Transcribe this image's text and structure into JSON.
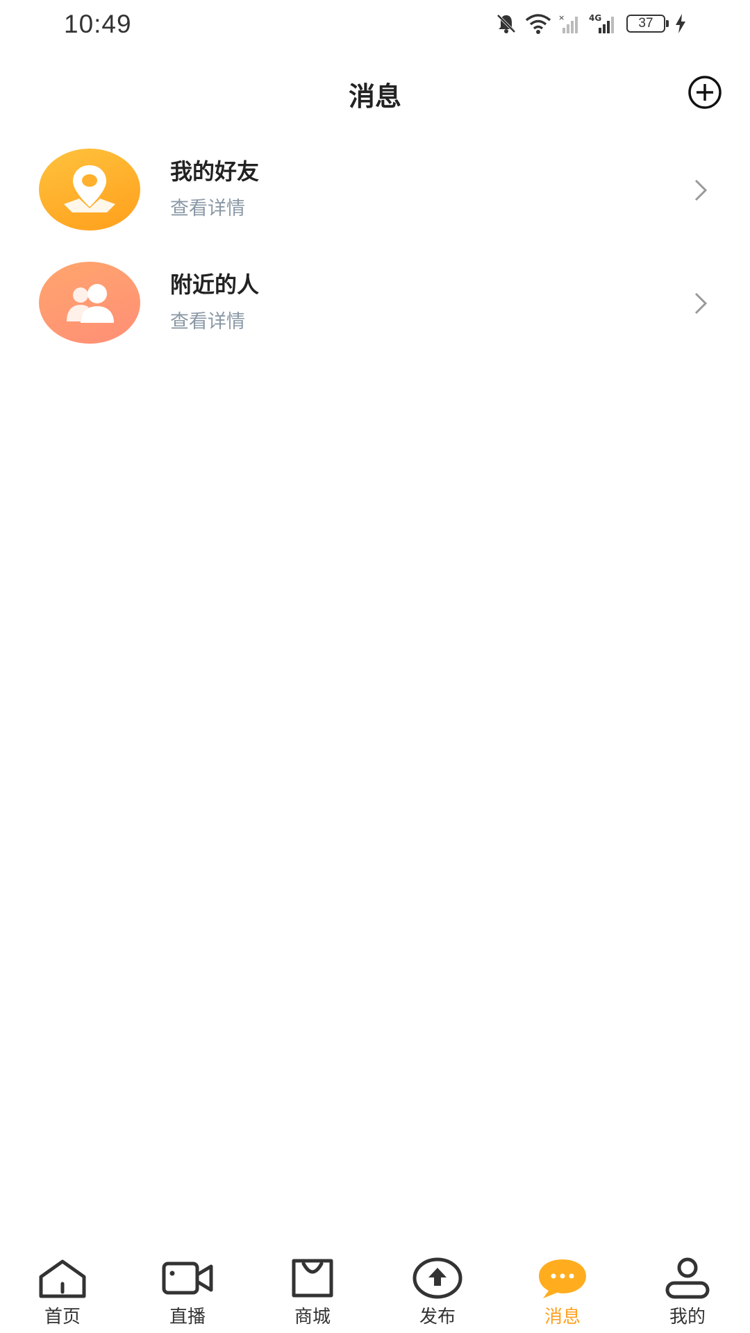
{
  "status_bar": {
    "time": "10:49",
    "battery": "37",
    "network": "4G"
  },
  "header": {
    "title": "消息",
    "add_icon": "plus-circle-icon"
  },
  "list": {
    "items": [
      {
        "title": "我的好友",
        "subtitle": "查看详情",
        "icon": "location-pin-icon",
        "color": "#ffb02e"
      },
      {
        "title": "附近的人",
        "subtitle": "查看详情",
        "icon": "users-icon",
        "color": "#ff9a72"
      }
    ]
  },
  "tab_bar": {
    "tabs": [
      {
        "label": "首页",
        "icon": "home-icon"
      },
      {
        "label": "直播",
        "icon": "video-camera-icon"
      },
      {
        "label": "商城",
        "icon": "shopping-bag-icon"
      },
      {
        "label": "发布",
        "icon": "upload-icon"
      },
      {
        "label": "消息",
        "icon": "chat-bubble-icon",
        "active": true
      },
      {
        "label": "我的",
        "icon": "user-icon"
      }
    ],
    "active_color": "#ff9f1c"
  }
}
